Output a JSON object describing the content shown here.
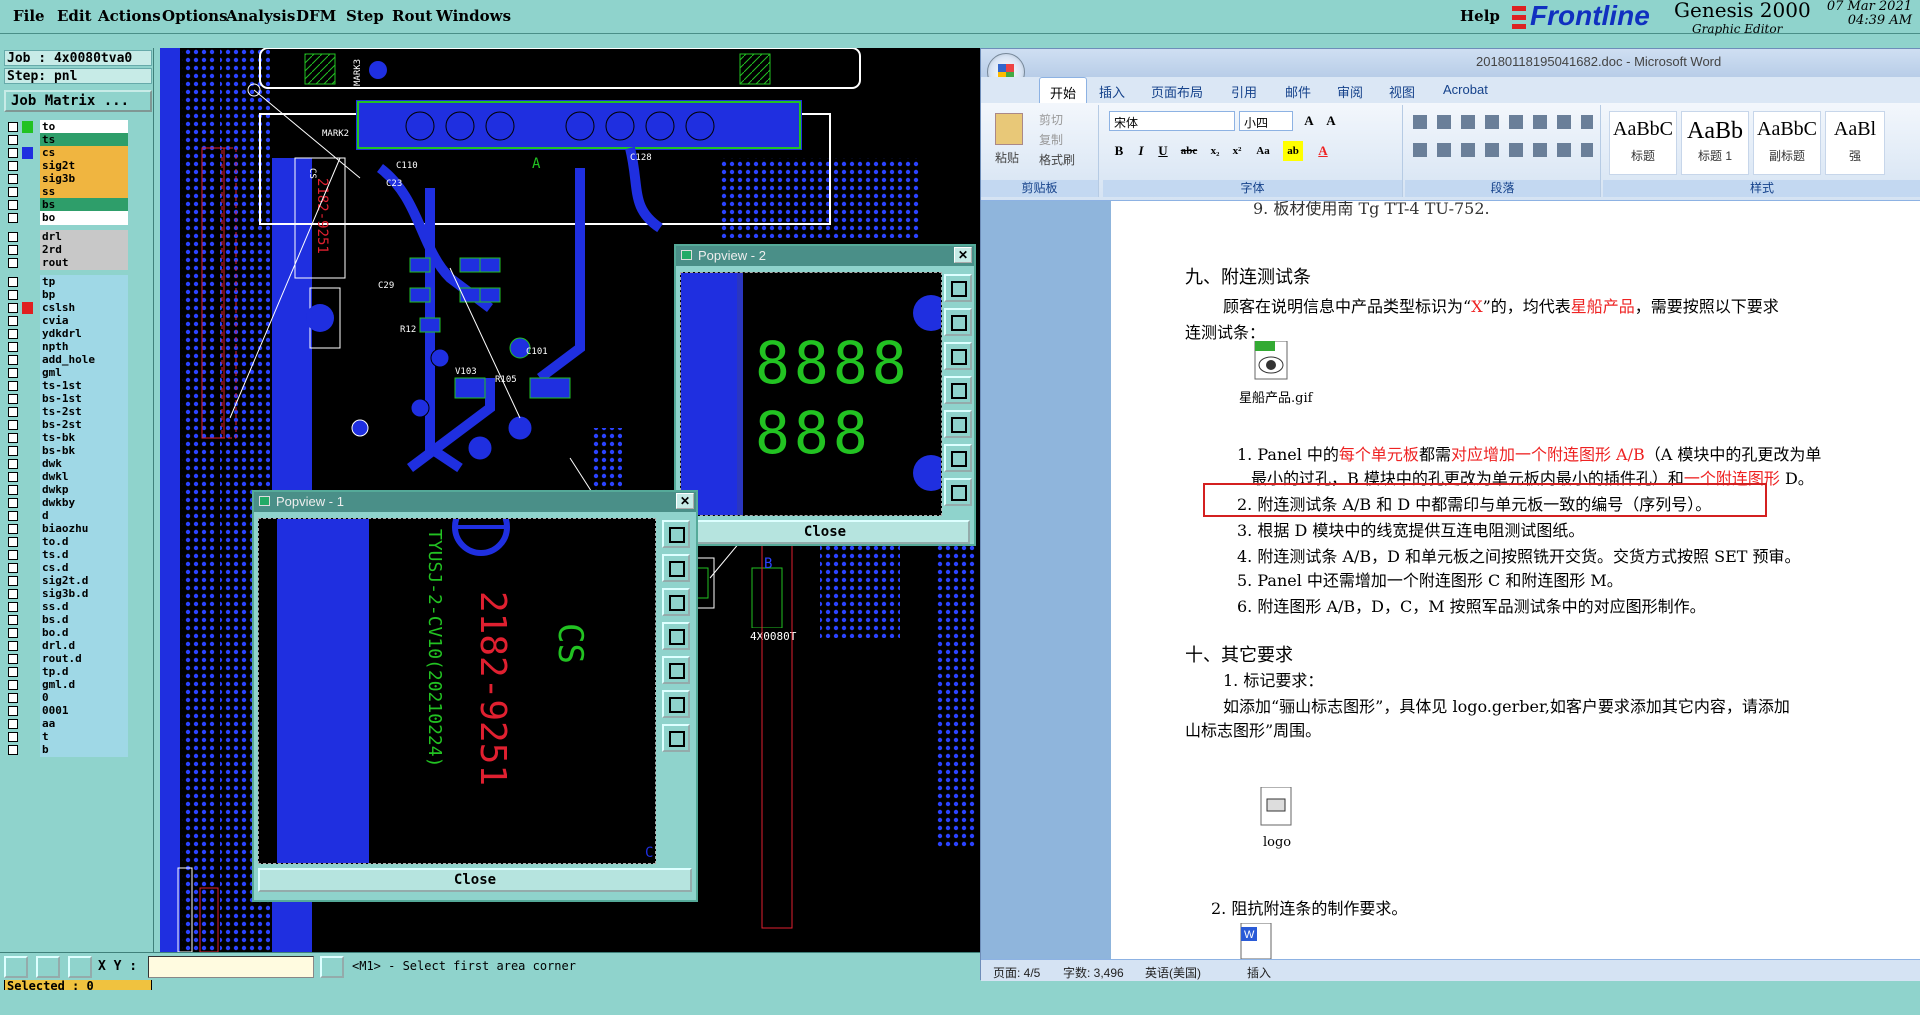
{
  "menubar": {
    "items": [
      "File",
      "Edit",
      "Actions",
      "Options",
      "Analysis",
      "DFM",
      "Step",
      "Rout",
      "Windows"
    ],
    "help": "Help"
  },
  "brand": {
    "frontline": "Frontline",
    "genesis": "Genesis 2000",
    "subtitle": "Graphic Editor"
  },
  "clock": {
    "date": "07 Mar 2021",
    "time": "04:39 AM"
  },
  "job": {
    "job_line": "Job : 4x0080tva0",
    "step_line": "Step: pnl",
    "matrix_button": "Job Matrix ..."
  },
  "layers": [
    {
      "name": "to",
      "color": "#ffffff",
      "swatch": "#22c222"
    },
    {
      "name": "ts",
      "color": "#2e9e6a",
      "swatch": ""
    },
    {
      "name": "cs",
      "color": "#f0b540",
      "swatch": "#1f2fe0"
    },
    {
      "name": "sig2t",
      "color": "#f0b540",
      "swatch": ""
    },
    {
      "name": "sig3b",
      "color": "#f0b540",
      "swatch": ""
    },
    {
      "name": "ss",
      "color": "#f0b540",
      "swatch": ""
    },
    {
      "name": "bs",
      "color": "#2e9e6a",
      "swatch": ""
    },
    {
      "name": "bo",
      "color": "#ffffff",
      "swatch": ""
    },
    {
      "name": "drl",
      "color": "#c8c8c8",
      "swatch": ""
    },
    {
      "name": "2rd",
      "color": "#c8c8c8",
      "swatch": ""
    },
    {
      "name": "rout",
      "color": "#c8c8c8",
      "swatch": ""
    },
    {
      "name": "tp",
      "color": "#9fd8e6",
      "swatch": ""
    },
    {
      "name": "bp",
      "color": "#9fd8e6",
      "swatch": ""
    },
    {
      "name": "cslsh",
      "color": "#9fd8e6",
      "swatch": "#e02020"
    },
    {
      "name": "cvia",
      "color": "#9fd8e6",
      "swatch": ""
    },
    {
      "name": "ydkdrl",
      "color": "#9fd8e6",
      "swatch": ""
    },
    {
      "name": "npth",
      "color": "#9fd8e6",
      "swatch": ""
    },
    {
      "name": "add_hole",
      "color": "#9fd8e6",
      "swatch": ""
    },
    {
      "name": "gml",
      "color": "#9fd8e6",
      "swatch": ""
    },
    {
      "name": "ts-1st",
      "color": "#9fd8e6",
      "swatch": ""
    },
    {
      "name": "bs-1st",
      "color": "#9fd8e6",
      "swatch": ""
    },
    {
      "name": "ts-2st",
      "color": "#9fd8e6",
      "swatch": ""
    },
    {
      "name": "bs-2st",
      "color": "#9fd8e6",
      "swatch": ""
    },
    {
      "name": "ts-bk",
      "color": "#9fd8e6",
      "swatch": ""
    },
    {
      "name": "bs-bk",
      "color": "#9fd8e6",
      "swatch": ""
    },
    {
      "name": "dwk",
      "color": "#9fd8e6",
      "swatch": ""
    },
    {
      "name": "dwkl",
      "color": "#9fd8e6",
      "swatch": ""
    },
    {
      "name": "dwkp",
      "color": "#9fd8e6",
      "swatch": ""
    },
    {
      "name": "dwkby",
      "color": "#9fd8e6",
      "swatch": ""
    },
    {
      "name": "d",
      "color": "#9fd8e6",
      "swatch": ""
    },
    {
      "name": "biaozhu",
      "color": "#9fd8e6",
      "swatch": ""
    },
    {
      "name": "to.d",
      "color": "#9fd8e6",
      "swatch": ""
    },
    {
      "name": "ts.d",
      "color": "#9fd8e6",
      "swatch": ""
    },
    {
      "name": "cs.d",
      "color": "#9fd8e6",
      "swatch": ""
    },
    {
      "name": "sig2t.d",
      "color": "#9fd8e6",
      "swatch": ""
    },
    {
      "name": "sig3b.d",
      "color": "#9fd8e6",
      "swatch": ""
    },
    {
      "name": "ss.d",
      "color": "#9fd8e6",
      "swatch": ""
    },
    {
      "name": "bs.d",
      "color": "#9fd8e6",
      "swatch": ""
    },
    {
      "name": "bo.d",
      "color": "#9fd8e6",
      "swatch": ""
    },
    {
      "name": "drl.d",
      "color": "#9fd8e6",
      "swatch": ""
    },
    {
      "name": "rout.d",
      "color": "#9fd8e6",
      "swatch": ""
    },
    {
      "name": "tp.d",
      "color": "#9fd8e6",
      "swatch": ""
    },
    {
      "name": "gml.d",
      "color": "#9fd8e6",
      "swatch": ""
    },
    {
      "name": "0",
      "color": "#9fd8e6",
      "swatch": ""
    },
    {
      "name": "0001",
      "color": "#9fd8e6",
      "swatch": ""
    },
    {
      "name": "aa",
      "color": "#9fd8e6",
      "swatch": ""
    },
    {
      "name": "t",
      "color": "#9fd8e6",
      "swatch": ""
    },
    {
      "name": "b",
      "color": "#9fd8e6",
      "swatch": ""
    }
  ],
  "selected": "Selected : 0",
  "statusbar": {
    "xy_label": "X Y :",
    "xy_value": "",
    "message": "<M1> - Select first area corner"
  },
  "popview1": {
    "title": "Popview - 1",
    "close": "Close",
    "text_a": "2182-9251",
    "text_b": "CS",
    "text_c": "TYUSJ-2-CV10(20210224)"
  },
  "popview2": {
    "title": "Popview - 2",
    "close": "Close",
    "digits1": "8888",
    "digits2": "888"
  },
  "canvas": {
    "mark1": "MARK3",
    "mark2": "MARK2",
    "ref_a": "2182-9251",
    "ref_b": "CS",
    "ref_c": "C110",
    "ref_d": "C128",
    "side": "4X0080T",
    "label_b": "B",
    "label_a": "A",
    "labels": [
      "C23",
      "C29",
      "R12",
      "C101",
      "V103",
      "R105"
    ]
  },
  "word": {
    "title": "20180118195041682.doc - Microsoft Word",
    "tabs": [
      "开始",
      "插入",
      "页面布局",
      "引用",
      "邮件",
      "审阅",
      "视图",
      "Acrobat"
    ],
    "clipboard": {
      "paste": "粘贴",
      "cut": "剪切",
      "copy": "复制",
      "format": "格式刷",
      "label": "剪贴板"
    },
    "font": {
      "name": "宋体",
      "size": "小四",
      "label": "字体"
    },
    "paragraph_label": "段落",
    "styles": [
      {
        "preview": "AaBbC",
        "name": "标题"
      },
      {
        "preview": "AaBb",
        "name": "标题 1"
      },
      {
        "preview": "AaBbC",
        "name": "副标题"
      },
      {
        "preview": "AaBl",
        "name": "强"
      }
    ],
    "styles_label": "样式",
    "doc": {
      "top_line": "9. 板材使用南 Tg TT-4 TU-752.",
      "h9": "九、附连测试条",
      "p1a": "顾客在说明信息中产品类型标识为“",
      "p1x": "X",
      "p1b": "”的，均代表",
      "p1red": "星船产品",
      "p1c": "，需要按照以下要求",
      "p1d": "连测试条：",
      "gif": "星船产品.gif",
      "i1a": "1. Panel 中的",
      "i1b": "每个单元板",
      "i1c": "都需",
      "i1d": "对应增加一个附连图形 A/B",
      "i1e": "（A 模块中的孔更改为单",
      "i1f": "最小的过孔，B 模块中的孔更改为单元板内最小的插件孔）和",
      "i1g": "一个附连图形",
      "i1h": " D。",
      "i2": "2. 附连测试条 A/B 和 D 中都需印与单元板一致的编号（序列号）。",
      "i3": "3. 根据 D 模块中的线宽提供互连电阻测试图纸。",
      "i4": "4. 附连测试条 A/B，D 和单元板之间按照铣开交货。交货方式按照 SET 预审。",
      "i5": "5. Panel 中还需增加一个附连图形 C 和附连图形 M。",
      "i6": "6. 附连图形 A/B，D，C，M 按照军品测试条中的对应图形制作。",
      "h10": "十、其它要求",
      "s1": "1. 标记要求：",
      "s1p": "如添加“骊山标志图形”，具体见 logo.gerber,如客户要求添加其它内容，请添加",
      "s1p2": "山标志图形”周围。",
      "logo": "logo",
      "s2a": "2. ",
      "s2b": "阻抗附连条",
      "s2c": "的制作要求。"
    },
    "status": {
      "page": "页面: 4/5",
      "words": "字数: 3,496",
      "lang": "英语(美国)",
      "mode": "插入"
    }
  },
  "colors": {
    "pcb_blue": "#1f2fe0",
    "pcb_dots": "#2b43ff",
    "silk_red": "#e02030",
    "copper_green": "#22c222",
    "annot_red": "#d42020"
  }
}
